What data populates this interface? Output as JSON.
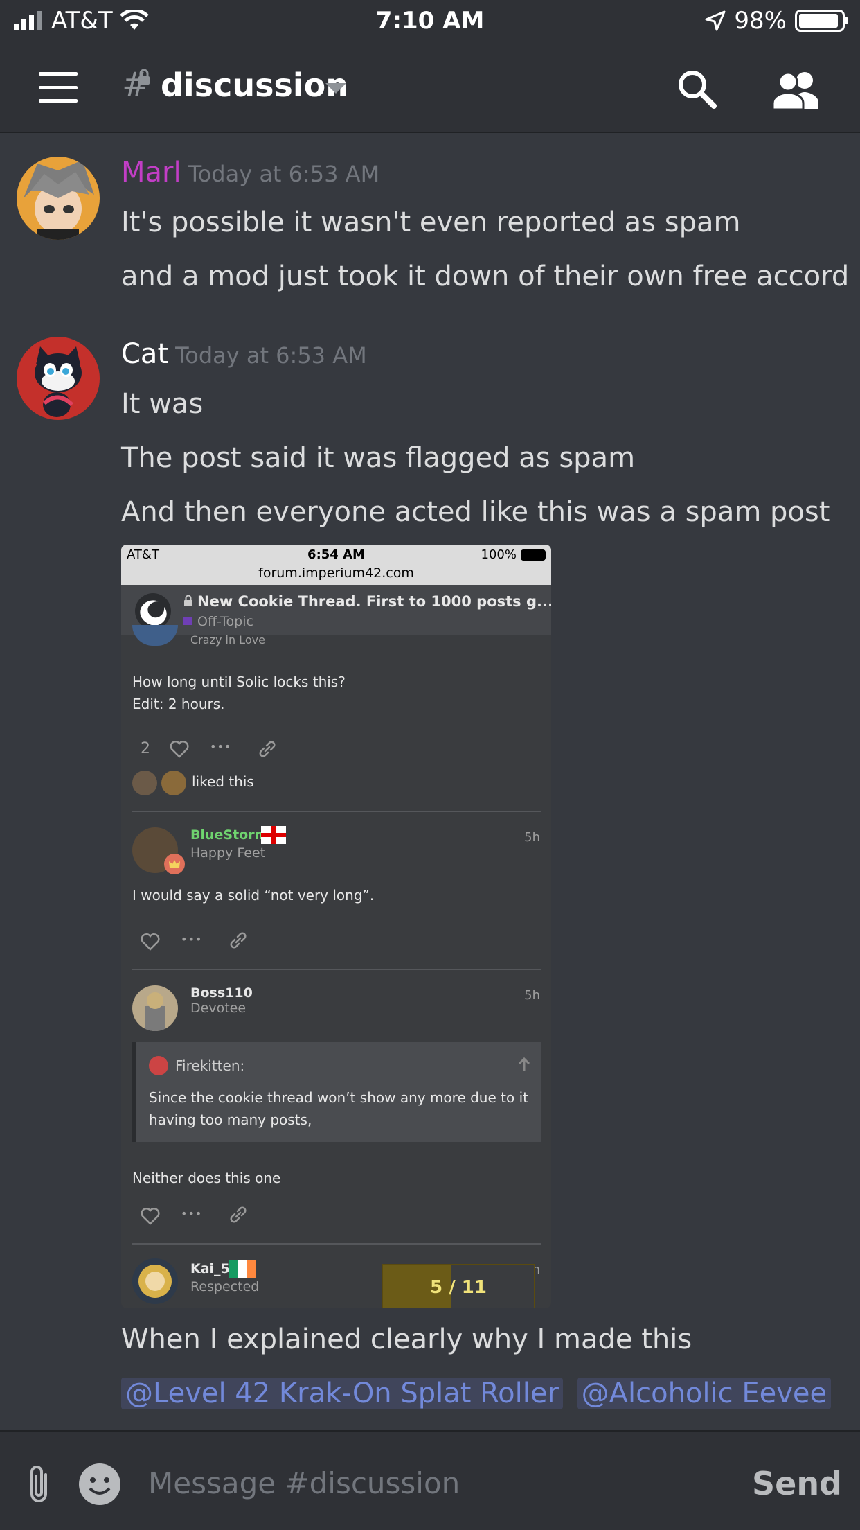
{
  "status_bar": {
    "carrier": "AT&T",
    "time": "7:10 AM",
    "battery": "98%"
  },
  "header": {
    "channel_hash": "#",
    "channel_name": "discussion"
  },
  "messages": [
    {
      "username": "Marl",
      "username_color": "#c23ec6",
      "timestamp": "Today at 6:53 AM",
      "lines": [
        "It's possible it wasn't even reported as spam",
        "and a mod just took it down of their own free accord"
      ]
    },
    {
      "username": "Cat",
      "username_color": "#ffffff",
      "timestamp": "Today at 6:53 AM",
      "lines": [
        "It was",
        "The post said it was flagged as spam",
        "And then everyone acted like this was a spam post"
      ],
      "after_lines": [
        "When I explained clearly why I made this"
      ],
      "mentions": [
        "@Level 42 Krak-On Splat Roller",
        "@Alcoholic Eevee"
      ]
    }
  ],
  "embed": {
    "status": {
      "carrier": "AT&T",
      "time": "6:54 AM",
      "battery": "100%",
      "url": "forum.imperium42.com"
    },
    "topic": {
      "title": "New Cookie Thread. First to 1000 posts g...",
      "category": "Off-Topic"
    },
    "post1": {
      "partial_title": "Crazy in Love",
      "body1": "How long until Solic locks this?",
      "body2": "Edit: 2 hours.",
      "like_count": "2",
      "liked_text": "liked this"
    },
    "post2": {
      "username": "BlueStorm",
      "user_title": "Happy Feet",
      "age": "5h",
      "body": "I would say a solid “not very long”."
    },
    "post3": {
      "username": "Boss110",
      "user_title": "Devotee",
      "age": "5h",
      "quote_author": "Firekitten:",
      "quote_line1": "Since the cookie thread won’t show any more due to it",
      "quote_line2": "having too many posts,",
      "body": "Neither does this one"
    },
    "post4": {
      "username": "Kai_5",
      "user_title": "Respected",
      "age": "h"
    },
    "pager": {
      "current": "5",
      "total": "11",
      "progress": 0.4545
    },
    "icons": {
      "more": "•••"
    }
  },
  "composer": {
    "placeholder": "Message #discussion",
    "send_label": "Send"
  }
}
